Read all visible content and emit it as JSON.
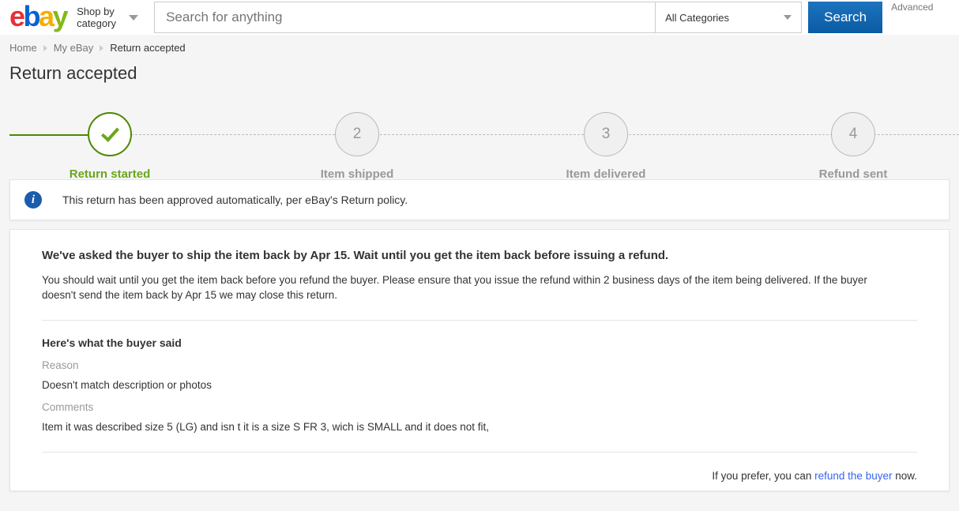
{
  "header": {
    "logo": {
      "e": "e",
      "b": "b",
      "a": "a",
      "y": "y"
    },
    "shop_by_category": "Shop by category",
    "search_placeholder": "Search for anything",
    "search_value": "",
    "category_selected": "All Categories",
    "search_button": "Search",
    "advanced_link": "Advanced"
  },
  "breadcrumb": [
    {
      "label": "Home",
      "current": false
    },
    {
      "label": "My eBay",
      "current": false
    },
    {
      "label": "Return accepted",
      "current": true
    }
  ],
  "page_title": "Return accepted",
  "stepper": {
    "steps": [
      {
        "marker": "✓",
        "label": "Return started",
        "state": "done"
      },
      {
        "marker": "2",
        "label": "Item shipped",
        "state": "todo"
      },
      {
        "marker": "3",
        "label": "Item delivered",
        "state": "todo"
      },
      {
        "marker": "4",
        "label": "Refund sent",
        "state": "todo"
      }
    ]
  },
  "info_banner": {
    "icon": "info-icon",
    "text": "This return has been approved automatically, per eBay's Return policy."
  },
  "main": {
    "heading": "We've asked the buyer to ship the item back by Apr 15. Wait until you get the item back before issuing a refund.",
    "body": "You should wait until you get the item back before you refund the buyer. Please ensure that you issue the refund within 2 business days of the item being delivered. If the buyer doesn't send the item back by Apr 15 we may close this return.",
    "buyer_section_heading": "Here's what the buyer said",
    "reason_label": "Reason",
    "reason_value": "Doesn't match description or photos",
    "comments_label": "Comments",
    "comments_value": "Item it was described size 5 (LG) and isn t it is a size S FR 3, wich is SMALL and it does not fit,",
    "footer_prefix": "If you prefer, you can ",
    "footer_link": "refund the buyer",
    "footer_suffix": " now."
  },
  "colors": {
    "ebay_red": "#e53238",
    "ebay_blue": "#0064d2",
    "ebay_yellow": "#f5af02",
    "ebay_green": "#86b817",
    "step_done_green": "#6aa61b",
    "link_blue": "#3665f3",
    "info_blue": "#1b5cad"
  }
}
